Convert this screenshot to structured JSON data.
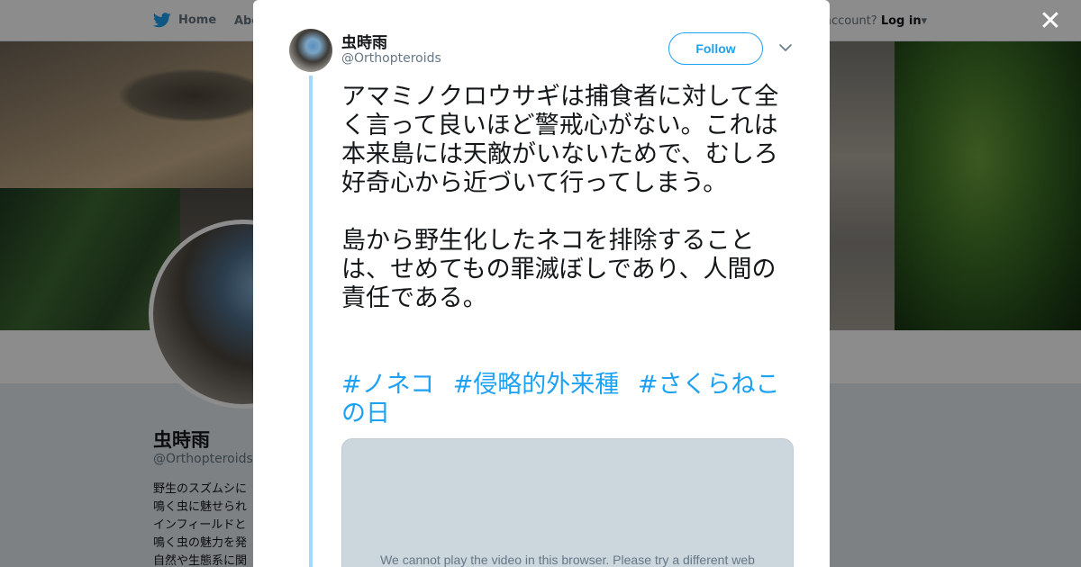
{
  "nav": {
    "home_label": "Home",
    "about_label": "Abo",
    "account_prompt": "account?",
    "login_label": "Log in"
  },
  "profile": {
    "name": "虫時雨",
    "handle": "@Orthopteroids",
    "bio_lines": [
      "野生のスズムシに",
      "鳴く虫に魅せられ",
      "インフィールドと",
      "鳴く虫の魅力を発",
      "自然や生態系に関"
    ]
  },
  "modal": {
    "author_name": "虫時雨",
    "author_handle": "@Orthopteroids",
    "follow_label": "Follow",
    "paragraph1": "アマミノクロウサギは捕食者に対して全く言って良いほど警戒心がない。これは本来島には天敵がいないためで、むしろ好奇心から近づいて行ってしまう。",
    "paragraph2": "島から野生化したネコを排除することは、せめてもの罪滅ぼしであり、人間の責任である。",
    "hashtags": [
      "#ノネコ",
      "#侵略的外来種",
      "#さくらねこの日"
    ],
    "video_message": "We cannot play the video in this browser. Please try a different web"
  },
  "colors": {
    "accent": "#1da1f2",
    "thread_line": "#a4d9f9",
    "overlay": "rgba(0,0,0,0.45)"
  },
  "icons": {
    "twitter": "twitter-bird-icon",
    "close": "close-icon",
    "chevron": "chevron-down-icon"
  }
}
